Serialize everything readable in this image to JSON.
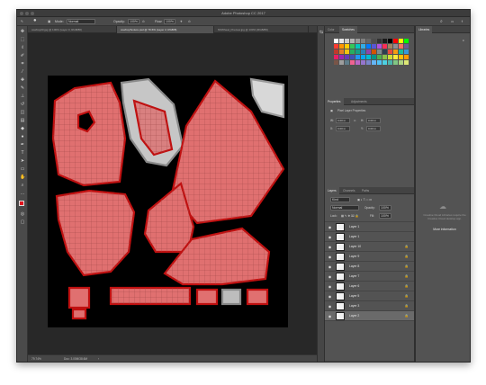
{
  "app": {
    "title": "Adobe Photoshop CC 2017"
  },
  "options_bar": {
    "mode_label": "Mode:",
    "mode_value": "Normal",
    "opacity_label": "Opacity:",
    "opacity_value": "100%",
    "flow_label": "Flow:",
    "flow_value": "100%"
  },
  "doc_tabs": [
    {
      "label": "cowboy03.jpg @ 100% (Layer 0, RGB/8#)"
    },
    {
      "label": "cowboyTexture.psd @ 79.6% (Layer 2, RGB/8)"
    },
    {
      "label": "NSWheat_Preview.jpg @ 100% (RGB/8#)"
    }
  ],
  "status": {
    "zoom": "79.74%",
    "doc": "Doc: 3.00M/38.6M"
  },
  "color_panel": {
    "tabs": [
      "Color",
      "Swatches"
    ],
    "active": "Swatches"
  },
  "swatch_colors": [
    "#ffffff",
    "#e6e6e6",
    "#cccccc",
    "#b3b3b3",
    "#999999",
    "#808080",
    "#666666",
    "#4d4d4d",
    "#333333",
    "#1a1a1a",
    "#000000",
    "#ff0000",
    "#ffff00",
    "#00ff00",
    "#ff3b30",
    "#ff9500",
    "#ffcc00",
    "#34c759",
    "#00c7be",
    "#32ade6",
    "#007aff",
    "#5856d6",
    "#af52de",
    "#ff2d55",
    "#a2845e",
    "#8e8e93",
    "#ff6f61",
    "#6b5b95",
    "#c0392b",
    "#e67e22",
    "#f1c40f",
    "#27ae60",
    "#16a085",
    "#2980b9",
    "#8e44ad",
    "#d35400",
    "#7f8c8d",
    "#2c3e50",
    "#e74c3c",
    "#f39c12",
    "#1abc9c",
    "#3498db",
    "#e91e63",
    "#9c27b0",
    "#673ab7",
    "#3f51b5",
    "#2196f3",
    "#03a9f4",
    "#00bcd4",
    "#009688",
    "#4caf50",
    "#8bc34a",
    "#cddc39",
    "#ffeb3b",
    "#ffc107",
    "#ff9800",
    "#795548",
    "#9e9e9e",
    "#607d8b",
    "#f06292",
    "#ba68c8",
    "#9575cd",
    "#7986cb",
    "#64b5f6",
    "#4fc3f7",
    "#4dd0e1",
    "#4db6ac",
    "#81c784",
    "#aed581",
    "#dce775"
  ],
  "properties_panel": {
    "tabs": [
      "Properties",
      "Adjustments"
    ],
    "active": "Properties",
    "title": "Pixel Layer Properties",
    "w_label": "W:",
    "w_value": "0.00 in",
    "h_label": "H:",
    "h_value": "0.00 in",
    "x_label": "X:",
    "x_value": "0.00 in",
    "y_label": "Y:",
    "y_value": "0.00 in"
  },
  "layers_panel": {
    "tabs": [
      "Layers",
      "Channels",
      "Paths"
    ],
    "active": "Layers",
    "kind_label": "Kind",
    "blend_mode": "Normal",
    "opacity_label": "Opacity:",
    "opacity_value": "100%",
    "lock_label": "Lock:",
    "fill_label": "Fill:",
    "fill_value": "100%",
    "layers": [
      {
        "name": "Layer 1",
        "selected": false,
        "locked": false
      },
      {
        "name": "Layer 1",
        "selected": false,
        "locked": false
      },
      {
        "name": "Layer 10",
        "selected": false,
        "locked": true
      },
      {
        "name": "Layer 9",
        "selected": false,
        "locked": true
      },
      {
        "name": "Layer 8",
        "selected": false,
        "locked": true
      },
      {
        "name": "Layer 7",
        "selected": false,
        "locked": true
      },
      {
        "name": "Layer 6",
        "selected": false,
        "locked": true
      },
      {
        "name": "Layer 5",
        "selected": false,
        "locked": true
      },
      {
        "name": "Layer 3",
        "selected": false,
        "locked": true
      },
      {
        "name": "Layer 2",
        "selected": true,
        "locked": true
      }
    ]
  },
  "libraries_panel": {
    "title": "Libraries",
    "message": "Creative Cloud Libraries require the Creative Cloud desktop app.",
    "link": "More information"
  }
}
